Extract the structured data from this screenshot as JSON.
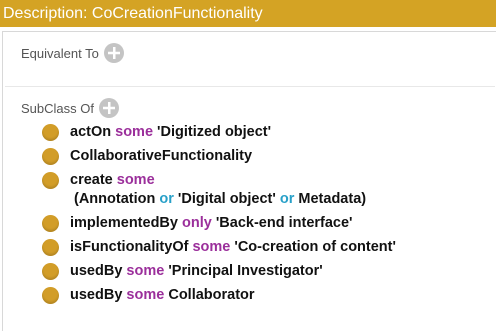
{
  "header": {
    "title": "Description: CoCreationFunctionality",
    "color": "#d4a324"
  },
  "sections": {
    "equivalent_to": {
      "label": "Equivalent To"
    },
    "subclass_of": {
      "label": "SubClass Of"
    }
  },
  "axioms": [
    {
      "a": "actOn",
      "b": "some",
      "c": "'Digitized object'"
    },
    {
      "a": "CollaborativeFunctionality"
    },
    {
      "a": "create",
      "b": "some",
      "c1": "(Annotation",
      "or1": "or",
      "c2": "'Digital object'",
      "or2": "or",
      "c3": "Metadata)"
    },
    {
      "a": "implementedBy",
      "b": "only",
      "c": "'Back-end interface'"
    },
    {
      "a": "isFunctionalityOf",
      "b": "some",
      "c": "'Co-creation of content'"
    },
    {
      "a": "usedBy",
      "b": "some",
      "c": "'Principal Investigator'"
    },
    {
      "a": "usedBy",
      "b": "some",
      "c": "Collaborator"
    }
  ],
  "colors": {
    "keyword": "#9b2f9b",
    "or_keyword": "#28a0c8",
    "bullet": "#d29d28"
  },
  "icons": {
    "add": "plus-circle-icon",
    "bullet": "class-bullet-icon"
  }
}
